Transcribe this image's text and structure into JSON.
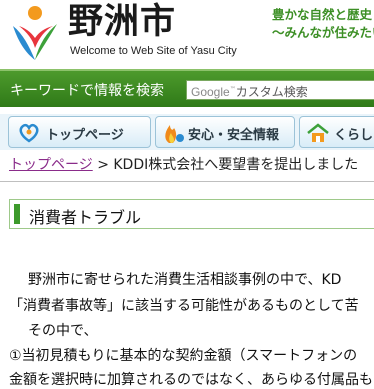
{
  "header": {
    "city_name": "野洲市",
    "welcome": "Welcome to Web Site of Yasu City",
    "slogan_line1": "豊かな自然と歴史",
    "slogan_line2": "〜みんなが住みたい"
  },
  "search": {
    "label": "キーワードで情報を検索",
    "google": "Google",
    "tm": "™",
    "placeholder": "カスタム検索"
  },
  "nav": {
    "tabs": [
      {
        "label": "トップページ",
        "icon": "home-heart-icon"
      },
      {
        "label": "安心・安全情報",
        "icon": "fire-safety-icon"
      },
      {
        "label": "くらし",
        "icon": "house-icon"
      }
    ]
  },
  "breadcrumb": {
    "home": "トップページ",
    "separator": ">",
    "current": "KDDI株式会社へ要望書を提出しました"
  },
  "page_title": "消費者トラブル",
  "body": {
    "lines": [
      "野洲市に寄せられた消費生活相談事例の中で、KD",
      "「消費者事故等」に該当する可能性があるものとして苦",
      "その中で、",
      "①当初見積もりに基本的な契約金額（スマートフォンの",
      "金額を選択時に加算されるのではなく、あらゆる付属品も"
    ]
  },
  "colors": {
    "brand_green": "#3d9a2c",
    "link_purple": "#8a2c8a",
    "nav_blue": "#d8ecf7"
  }
}
